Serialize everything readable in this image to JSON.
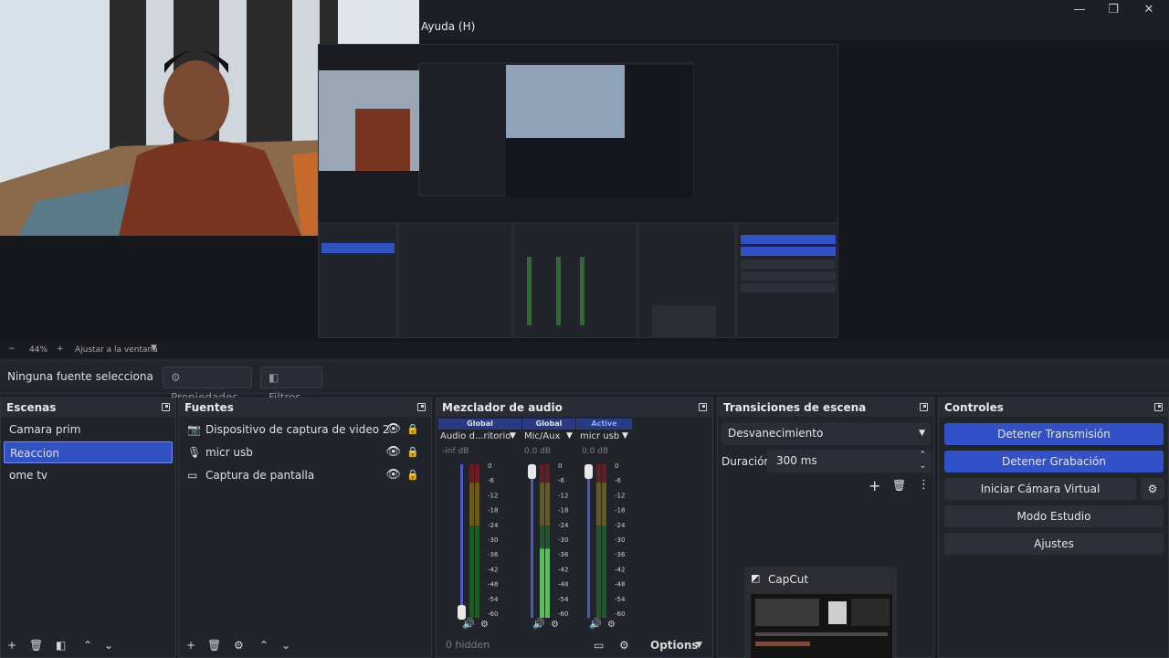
{
  "menu": {
    "help": "Ayuda (H)"
  },
  "window_controls": {
    "minimize": "—",
    "restore": "❐",
    "close": "✕"
  },
  "preview": {
    "zoom": "44%",
    "zoom_minus": "−",
    "zoom_plus": "+",
    "fit_label": "Ajustar a la ventana"
  },
  "source_bar": {
    "status": "Ninguna fuente selecciona",
    "properties": "Propiedades",
    "filters": "Filtros"
  },
  "scenes": {
    "title": "Escenas",
    "items": [
      "Camara prim",
      "Reaccion",
      "ome tv"
    ],
    "selected": 1
  },
  "sources": {
    "title": "Fuentes",
    "items": [
      {
        "label": "Dispositivo de captura de video 2",
        "icon": "camera-icon"
      },
      {
        "label": "micr usb",
        "icon": "microphone-icon"
      },
      {
        "label": "Captura de pantalla",
        "icon": "monitor-icon"
      }
    ]
  },
  "mixer": {
    "title": "Mezclador de audio",
    "channels": [
      {
        "tag": "Global",
        "name": "Audio d...ritorio",
        "db": "-inf dB",
        "level": 0.0
      },
      {
        "tag": "Global",
        "name": "Mic/Aux",
        "db": "0.0 dB",
        "level": 0.45
      },
      {
        "tag": "Active",
        "name": "micr usb",
        "db": "0.0 dB",
        "level": 0.0
      }
    ],
    "scale": [
      "0",
      "-6",
      "-12",
      "-18",
      "-24",
      "-30",
      "-36",
      "-42",
      "-48",
      "-54",
      "-60"
    ],
    "hidden": "0 hidden",
    "options": "Options"
  },
  "transitions": {
    "title": "Transiciones de escena",
    "selected": "Desvanecimiento",
    "duration_label": "Duración",
    "duration_value": "300 ms"
  },
  "controls": {
    "title": "Controles",
    "stop_stream": "Detener Transmisión",
    "stop_record": "Detener Grabación",
    "virtual_cam": "Iniciar Cámara Virtual",
    "studio_mode": "Modo Estudio",
    "settings": "Ajustes"
  },
  "taskbar_preview": {
    "title": "CapCut"
  },
  "colors": {
    "accent": "#3151c8",
    "panel": "#22242b",
    "meter_green": "#4bc94b"
  }
}
